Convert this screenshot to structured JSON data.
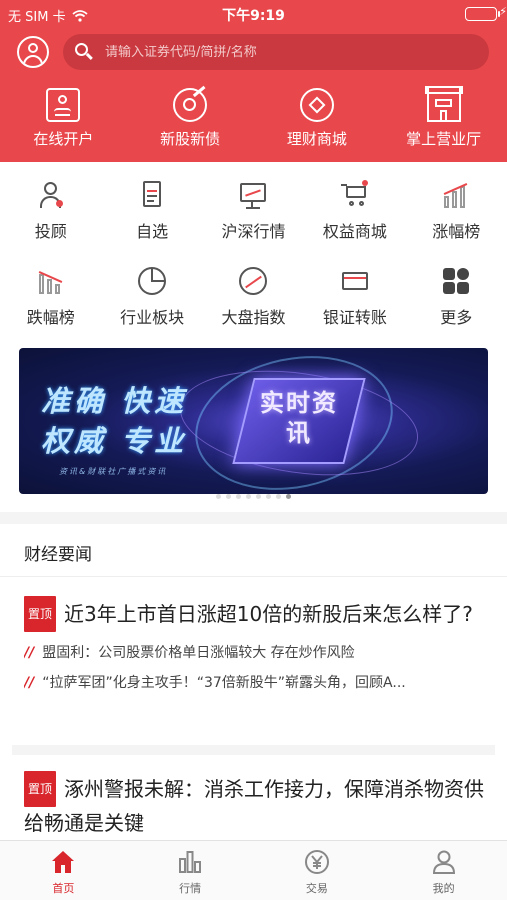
{
  "status_bar": {
    "carrier": "无 SIM 卡",
    "time": "下午9:19"
  },
  "search": {
    "placeholder": "请输入证券代码/简拼/名称"
  },
  "top_actions": [
    {
      "label": "在线开户",
      "icon": "portrait-card-icon"
    },
    {
      "label": "新股新债",
      "icon": "target-arrow-icon"
    },
    {
      "label": "理财商城",
      "icon": "coin-diamond-icon"
    },
    {
      "label": "掌上营业厅",
      "icon": "shop-icon"
    }
  ],
  "grid": [
    {
      "label": "投顾",
      "icon": "advisor-icon"
    },
    {
      "label": "自选",
      "icon": "watchlist-icon"
    },
    {
      "label": "沪深行情",
      "icon": "monitor-icon"
    },
    {
      "label": "权益商城",
      "icon": "cart-icon"
    },
    {
      "label": "涨幅榜",
      "icon": "rise-chart-icon"
    },
    {
      "label": "跌幅榜",
      "icon": "fall-chart-icon"
    },
    {
      "label": "行业板块",
      "icon": "pie-icon"
    },
    {
      "label": "大盘指数",
      "icon": "index-circle-icon"
    },
    {
      "label": "银证转账",
      "icon": "card-icon"
    },
    {
      "label": "更多",
      "icon": "more-grid-icon"
    }
  ],
  "banner": {
    "line1": "准确 快速",
    "line2": "权威 专业",
    "chip_text": "实时资讯",
    "sub": "资讯&财联社广播式资讯",
    "slides": 8,
    "active_slide": 8
  },
  "news": {
    "section_title": "财经要闻",
    "items": [
      {
        "tag": "置顶",
        "headline": "近3年上市首日涨超10倍的新股后来怎么样了?",
        "subs": [
          "盟固利：公司股票价格单日涨幅较大 存在炒作风险",
          "“拉萨军团”化身主攻手！“37倍新股牛”崭露头角，回顾A..."
        ]
      },
      {
        "tag": "置顶",
        "headline": "涿州警报未解：消杀工作接力，保障消杀物资供给畅通是关键",
        "subs": []
      }
    ]
  },
  "tabbar": [
    {
      "label": "首页",
      "icon": "home-icon",
      "active": true
    },
    {
      "label": "行情",
      "icon": "bars-icon",
      "active": false
    },
    {
      "label": "交易",
      "icon": "yen-icon",
      "active": false
    },
    {
      "label": "我的",
      "icon": "person-icon",
      "active": false
    }
  ],
  "colors": {
    "brand_red": "#e8484c",
    "tag_red": "#d8262c"
  }
}
